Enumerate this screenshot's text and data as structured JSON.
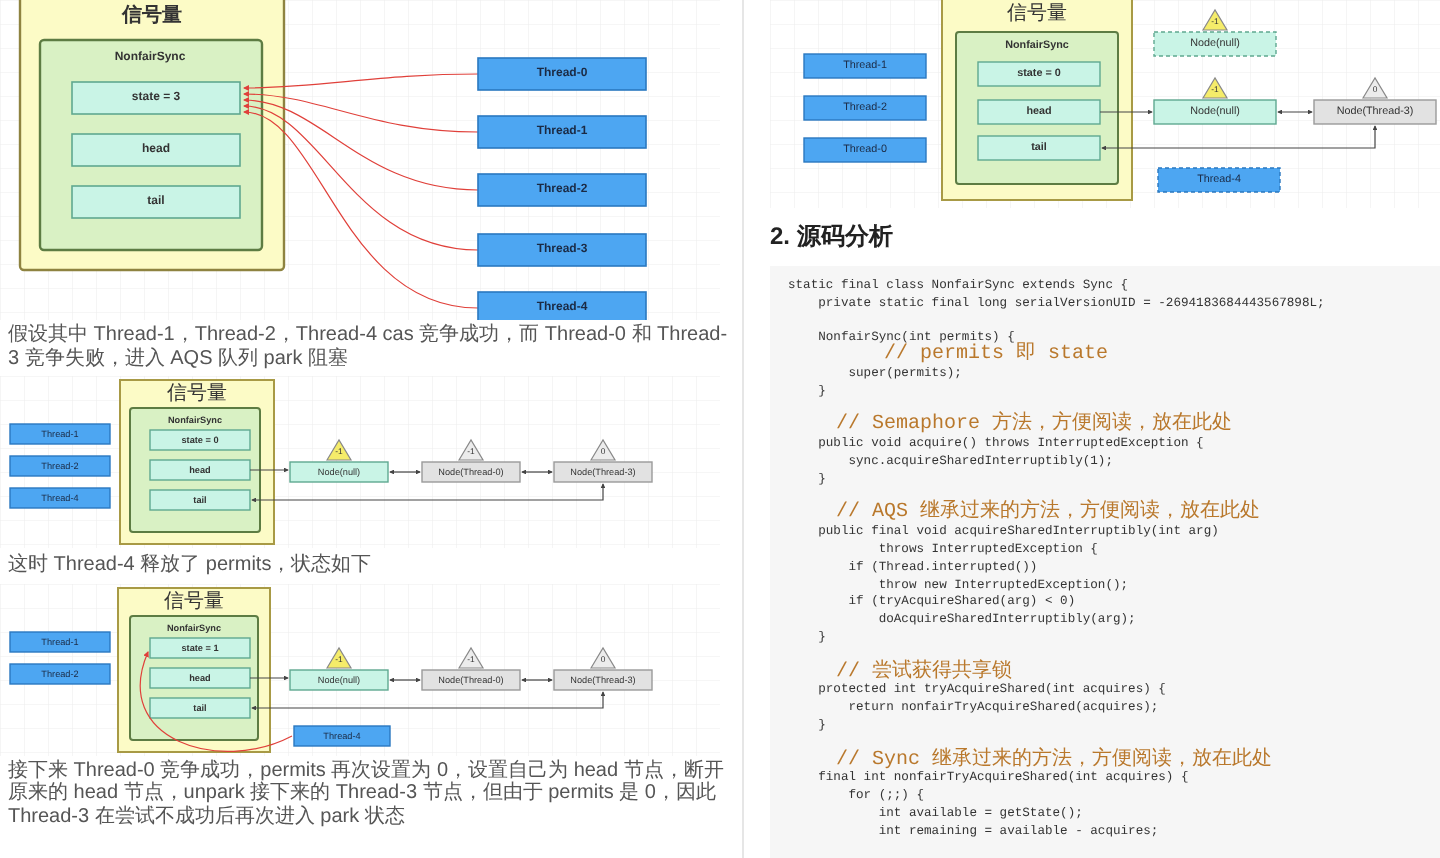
{
  "left_page": {
    "diagram_1": {
      "semaphore_title": "信号量",
      "sync_title": "NonfairSync",
      "fields": [
        "state = 3",
        "head",
        "tail"
      ],
      "threads": [
        "Thread-0",
        "Thread-1",
        "Thread-2",
        "Thread-3",
        "Thread-4"
      ]
    },
    "paragraph_1": "假设其中 Thread-1，Thread-2，Thread-4 cas 竞争成功，而 Thread-0 和 Thread-3 竞争失败，进入 AQS 队列 park 阻塞",
    "diagram_2": {
      "semaphore_title": "信号量",
      "sync_title": "NonfairSync",
      "fields": [
        "state = 0",
        "head",
        "tail"
      ],
      "threads": [
        "Thread-1",
        "Thread-2",
        "Thread-4"
      ],
      "nodes": [
        {
          "label": "Node(null)",
          "status": "-1",
          "kind": "head"
        },
        {
          "label": "Node(Thread-0)",
          "status": "-1",
          "kind": "queued"
        },
        {
          "label": "Node(Thread-3)",
          "status": "0",
          "kind": "queued"
        }
      ]
    },
    "paragraph_2": "这时 Thread-4 释放了 permits，状态如下",
    "diagram_3": {
      "semaphore_title": "信号量",
      "sync_title": "NonfairSync",
      "fields": [
        "state = 1",
        "head",
        "tail"
      ],
      "threads": [
        "Thread-1",
        "Thread-2"
      ],
      "nodes": [
        {
          "label": "Node(null)",
          "status": "-1",
          "kind": "head"
        },
        {
          "label": "Node(Thread-0)",
          "status": "-1",
          "kind": "queued"
        },
        {
          "label": "Node(Thread-3)",
          "status": "0",
          "kind": "queued"
        }
      ],
      "released_thread": "Thread-4"
    },
    "paragraph_3": "接下来 Thread-0 竞争成功，permits 再次设置为 0，设置自己为 head 节点，断开原来的 head 节点，unpark 接下来的 Thread-3 节点，但由于 permits 是 0，因此 Thread-3 在尝试不成功后再次进入 park 状态"
  },
  "right_page": {
    "diagram": {
      "semaphore_title": "信号量",
      "sync_title": "NonfairSync",
      "fields": [
        "state = 0",
        "head",
        "tail"
      ],
      "threads": [
        "Thread-1",
        "Thread-2",
        "Thread-0"
      ],
      "detached_node": {
        "label": "Node(null)",
        "status": "-1",
        "kind": "head"
      },
      "nodes": [
        {
          "label": "Node(null)",
          "status": "-1",
          "kind": "head"
        },
        {
          "label": "Node(Thread-3)",
          "status": "0",
          "kind": "queued"
        }
      ],
      "released_thread": "Thread-4"
    },
    "heading": "2. 源码分析",
    "code_lines": [
      {
        "kind": "code",
        "text": "static final class NonfairSync extends Sync {"
      },
      {
        "kind": "code",
        "text": "    private static final long serialVersionUID = -2694183684443567898L;"
      },
      {
        "kind": "blank"
      },
      {
        "kind": "code",
        "text": "    NonfairSync(int permits) {"
      },
      {
        "kind": "comment",
        "text": "        // permits 即 state"
      },
      {
        "kind": "code",
        "text": "        super(permits);"
      },
      {
        "kind": "code",
        "text": "    }"
      },
      {
        "kind": "blank"
      },
      {
        "kind": "comment",
        "text": "    // Semaphore 方法，方便阅读，放在此处"
      },
      {
        "kind": "code",
        "text": "    public void acquire() throws InterruptedException {"
      },
      {
        "kind": "code",
        "text": "        sync.acquireSharedInterruptibly(1);"
      },
      {
        "kind": "code",
        "text": "    }"
      },
      {
        "kind": "blank"
      },
      {
        "kind": "comment",
        "text": "    // AQS 继承过来的方法，方便阅读，放在此处"
      },
      {
        "kind": "code",
        "text": "    public final void acquireSharedInterruptibly(int arg)"
      },
      {
        "kind": "code",
        "text": "            throws InterruptedException {"
      },
      {
        "kind": "code",
        "text": "        if (Thread.interrupted())"
      },
      {
        "kind": "code",
        "text": "            throw new InterruptedException();"
      },
      {
        "kind": "code",
        "text": "        if (tryAcquireShared(arg) < 0)"
      },
      {
        "kind": "code",
        "text": "            doAcquireSharedInterruptibly(arg);"
      },
      {
        "kind": "code",
        "text": "    }"
      },
      {
        "kind": "blank"
      },
      {
        "kind": "comment",
        "text": "    // 尝试获得共享锁"
      },
      {
        "kind": "code",
        "text": "    protected int tryAcquireShared(int acquires) {"
      },
      {
        "kind": "code",
        "text": "        return nonfairTryAcquireShared(acquires);"
      },
      {
        "kind": "code",
        "text": "    }"
      },
      {
        "kind": "blank"
      },
      {
        "kind": "comment",
        "text": "    // Sync 继承过来的方法，方便阅读，放在此处"
      },
      {
        "kind": "code",
        "text": "    final int nonfairTryAcquireShared(int acquires) {"
      },
      {
        "kind": "code",
        "text": "        for (;;) {"
      },
      {
        "kind": "code",
        "text": "            int available = getState();"
      },
      {
        "kind": "code",
        "text": "            int remaining = available - acquires;"
      }
    ]
  }
}
